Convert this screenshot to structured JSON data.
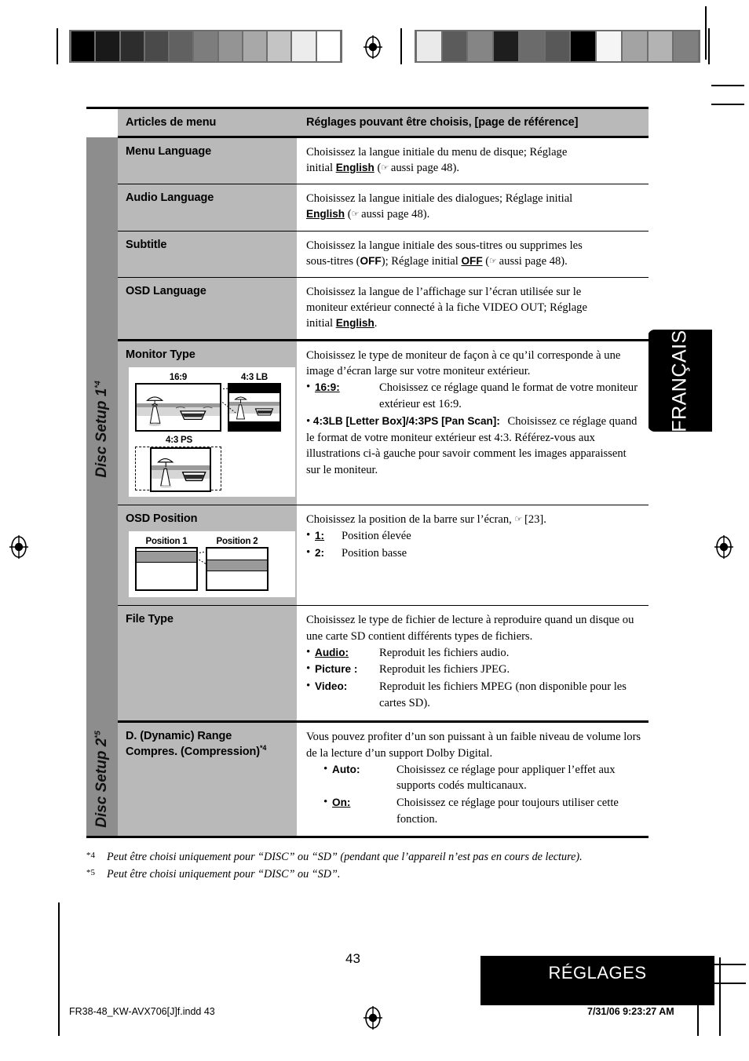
{
  "document": {
    "language_tab": "FRANÇAIS",
    "page_number": "43",
    "footer_section": "RÉGLAGES",
    "file_name": "FR38-48_KW-AVX706[J]f.indd   43",
    "print_timestamp": "7/31/06   9:23:27 AM"
  },
  "table": {
    "header": {
      "col_items": "Articles de menu",
      "col_settings": "Réglages pouvant être choisis, [page de référence]"
    },
    "groups": [
      {
        "label": "Disc Setup 1",
        "footnote_mark": "*4"
      },
      {
        "label": "Disc Setup 2",
        "footnote_mark": "*5"
      }
    ],
    "rows": [
      {
        "item": "Menu Language",
        "desc_1": "Choisissez la langue initiale du menu de disque; Réglage",
        "desc_2_pre": "initial ",
        "desc_2_bold": "English",
        "desc_2_post": " (",
        "desc_2_tail": " aussi page 48)."
      },
      {
        "item": "Audio Language",
        "desc_1": "Choisissez la langue initiale des dialogues; Réglage initial",
        "desc_2_bold": "English",
        "desc_2_post": " (",
        "desc_2_tail": " aussi page 48)."
      },
      {
        "item": "Subtitle",
        "desc_1": "Choisissez la langue initiale des sous-titres ou supprimes les",
        "desc_2_pre": "sous-titres (",
        "desc_2_b1": "OFF",
        "desc_2_mid": "); Réglage initial ",
        "desc_2_b2": "OFF",
        "desc_2_post": " (",
        "desc_2_tail": " aussi page 48)."
      },
      {
        "item": "OSD Language",
        "desc_1": "Choisissez la langue de l’affichage sur l’écran utilisée sur le",
        "desc_2": "moniteur extérieur connecté à la fiche VIDEO OUT; Réglage",
        "desc_3_pre": "initial ",
        "desc_3_bold": "English",
        "desc_3_post": "."
      },
      {
        "item": "Monitor Type",
        "intro": "Choisissez le type de moniteur de façon à ce qu’il corresponde à une image d’écran large sur votre moniteur extérieur.",
        "bullets": [
          {
            "term": "16:9:",
            "underline": true,
            "def": "Choisissez ce réglage quand le format de votre moniteur extérieur est 16:9."
          },
          {
            "term": "4:3LB [Letter Box]/4:3PS [Pan Scan]:",
            "underline": false,
            "def": "Choisissez ce réglage quand le format de votre moniteur extérieur est 4:3. Référez-vous aux illustrations ci-à gauche pour savoir comment les images apparaissent sur le moniteur."
          }
        ],
        "illustration": {
          "captions": [
            "16:9",
            "4:3 LB",
            "4:3 PS"
          ],
          "scene": "beach-umbrella-boat"
        }
      },
      {
        "item": "OSD Position",
        "intro_pre": "Choisissez la position de la barre sur l’écran, ",
        "intro_post": " [23].",
        "bullets": [
          {
            "term": "1:",
            "underline": true,
            "def": "Position élevée"
          },
          {
            "term": "2:",
            "underline": false,
            "def": "Position basse"
          }
        ],
        "illustration": {
          "captions": [
            "Position 1",
            "Position 2"
          ]
        }
      },
      {
        "item": "File Type",
        "intro": "Choisissez le type de fichier de lecture à reproduire quand un disque ou une carte SD contient différents types de fichiers.",
        "bullets": [
          {
            "term": "Audio:",
            "underline": true,
            "def": "Reproduit les fichiers audio."
          },
          {
            "term": "Picture :",
            "underline": false,
            "def": "Reproduit les fichiers JPEG."
          },
          {
            "term": "Video:",
            "underline": false,
            "def": "Reproduit les fichiers MPEG (non disponible pour les cartes SD)."
          }
        ]
      },
      {
        "item_line1": "D. (Dynamic) Range",
        "item_line2": "Compres. (Compression)",
        "item_sup": "*4",
        "intro": "Vous pouvez profiter d’un son puissant à un faible niveau de volume lors de la lecture d’un support Dolby Digital.",
        "bullets": [
          {
            "term": "Auto:",
            "underline": false,
            "def": "Choisissez ce réglage pour appliquer l’effet aux supports codés multicanaux."
          },
          {
            "term": "On:",
            "underline": true,
            "def": "Choisissez ce réglage pour toujours utiliser cette fonction."
          }
        ]
      }
    ]
  },
  "footnotes": [
    {
      "mark": "*4",
      "text": "Peut être choisi uniquement pour “DISC” ou “SD” (pendant que l’appareil n’est pas en cours de lecture)."
    },
    {
      "mark": "*5",
      "text": "Peut être choisi uniquement pour “DISC” ou “SD”."
    }
  ],
  "calibration": {
    "left_bar": [
      "#000000",
      "#191919",
      "#2d2d2d",
      "#4a4a4a",
      "#616161",
      "#7d7d7d",
      "#949494",
      "#a8a8a8",
      "#c4c4c4",
      "#ececec",
      "#ffffff"
    ],
    "right_bar": [
      "#eaeaea",
      "#5b5b5b",
      "#858585",
      "#1e1e1e",
      "#6b6b6b",
      "#585858",
      "#000000",
      "#f5f5f5",
      "#a3a3a3",
      "#b3b3b3",
      "#808080"
    ]
  },
  "colors": {
    "header_gray": "#b9b9b9",
    "side_gray": "#8d8d8d",
    "cell_gray": "#b9b9b9",
    "black": "#000000",
    "white": "#ffffff"
  }
}
